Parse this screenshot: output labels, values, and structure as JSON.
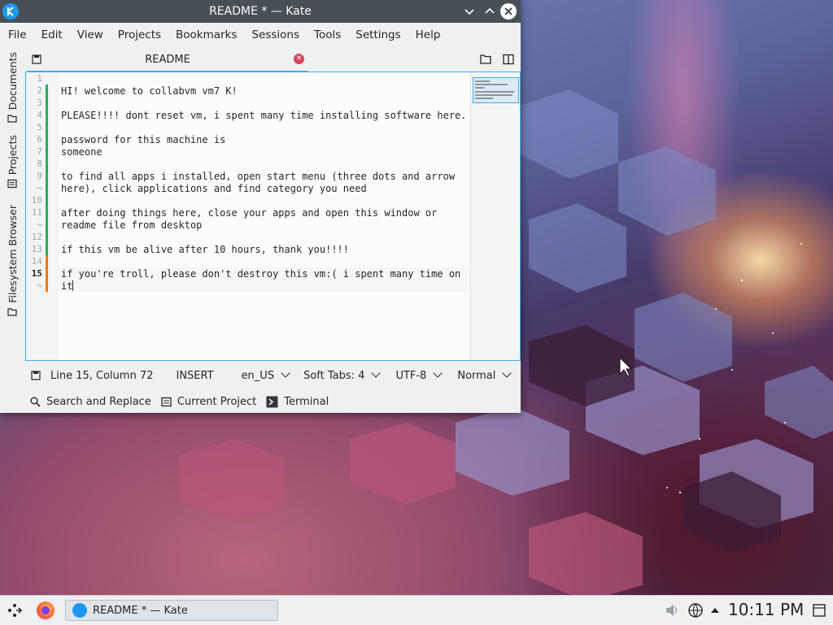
{
  "window": {
    "title": "README * — Kate",
    "menu": [
      "File",
      "Edit",
      "View",
      "Projects",
      "Bookmarks",
      "Sessions",
      "Tools",
      "Settings",
      "Help"
    ],
    "side_tabs": [
      "Documents",
      "Projects",
      "Filesystem Browser"
    ],
    "tab": {
      "label": "README"
    }
  },
  "editor": {
    "gutter": [
      "1",
      "2",
      "3",
      "4",
      "5",
      "6",
      "7",
      "8",
      "9",
      "↪",
      "10",
      "11",
      "↪",
      "12",
      "13",
      "14",
      "15",
      "↪"
    ],
    "lines": [
      "",
      "HI! welcome to collabvm vm7 K!",
      "",
      "PLEASE!!!! dont reset vm, i spent many time installing software here.",
      "",
      "password for this machine is",
      "someone",
      "",
      "to find all apps i installed, open start menu (three dots and arrow",
      "here), click applications and find category you need",
      "",
      "after doing things here, close your apps and open this window or",
      "readme file from desktop",
      "",
      "if this vm be alive after 10 hours, thank you!!!!",
      "",
      "if you're troll, please don't destroy this vm:( i spent many time on",
      "it"
    ]
  },
  "status": {
    "position": "Line 15, Column 72",
    "mode": "INSERT",
    "language": "en_US",
    "indent": "Soft Tabs: 4",
    "encoding": "UTF-8",
    "highlight": "Normal"
  },
  "tools": {
    "search": "Search and Replace",
    "project": "Current Project",
    "terminal": "Terminal"
  },
  "taskbar": {
    "task_label": "README * — Kate",
    "clock": "10:11 PM"
  },
  "colors": {
    "accent": "#3daee9",
    "titlebar": "#475057",
    "modified_green": "#27ae60",
    "modified_orange": "#f67400",
    "close_red": "#da4453"
  }
}
